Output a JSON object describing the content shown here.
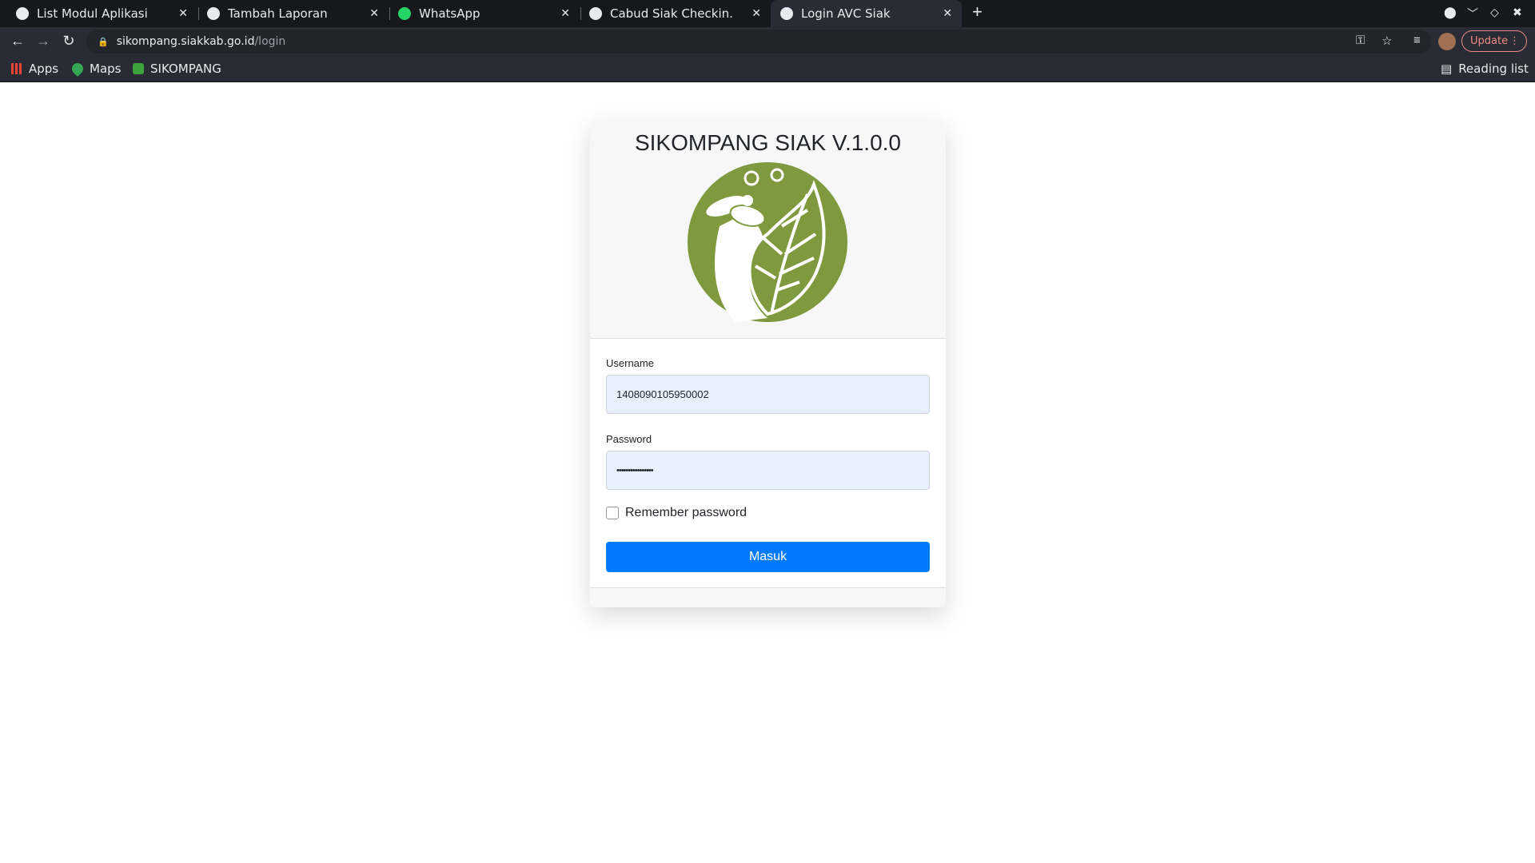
{
  "browser": {
    "tabs": [
      {
        "label": "List Modul Aplikasi",
        "icon": "globe-icon"
      },
      {
        "label": "Tambah Laporan",
        "icon": "globe-icon"
      },
      {
        "label": "WhatsApp",
        "icon": "whatsapp-icon"
      },
      {
        "label": "Cabud Siak Checkin.",
        "icon": "globe-icon"
      },
      {
        "label": "Login AVC Siak",
        "icon": "globe-icon",
        "active": true
      }
    ],
    "url_host": "sikompang.siakkab.go.id",
    "url_path": "/login",
    "update_label": "Update",
    "bookmarks": [
      {
        "label": "Apps"
      },
      {
        "label": "Maps"
      },
      {
        "label": "SIKOMPANG"
      }
    ],
    "reading_list": "Reading list"
  },
  "login": {
    "title": "SIKOMPANG SIAK V.1.0.0",
    "username_label": "Username",
    "username_value": "1408090105950002",
    "password_label": "Password",
    "password_value": "••••••••••••••••",
    "remember_label": "Remember password",
    "remember_checked": false,
    "submit_label": "Masuk",
    "logo_color": "#7f9a3e",
    "button_color": "#007bff"
  }
}
